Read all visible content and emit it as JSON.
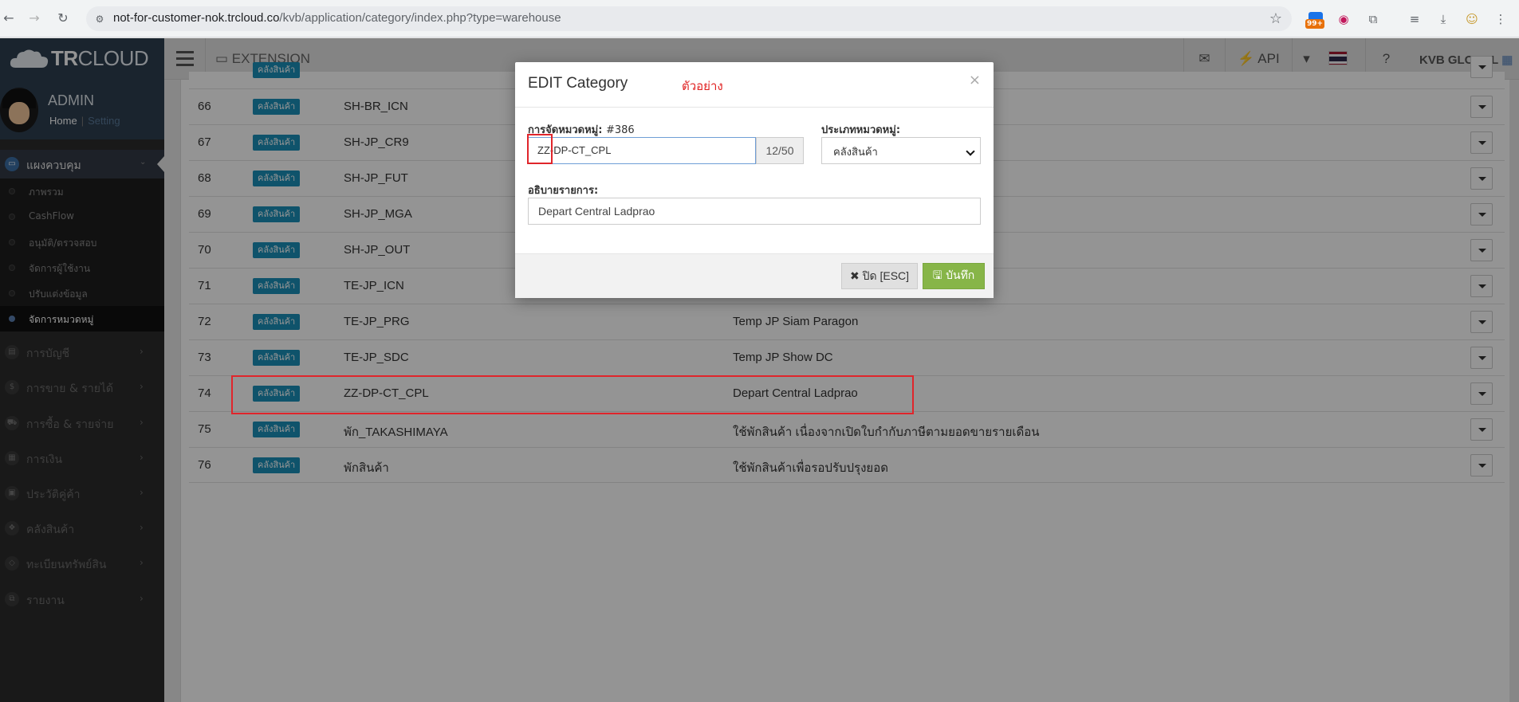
{
  "browser": {
    "url_host": "not-for-customer-nok.trcloud.co",
    "url_path": "/kvb/application/category/index.php?type=warehouse",
    "notif_count": "99+"
  },
  "header": {
    "brand_bold": "TR",
    "brand_light": "CLOUD",
    "extension_label": "EXTENSION",
    "api_label": "API",
    "company": "KVB GLOBAL"
  },
  "sidebar": {
    "user_name": "ADMIN",
    "home_link": "Home",
    "setting_link": "Setting",
    "main_menu": "แผงควบคุม",
    "sub_items": [
      {
        "label": "ภาพรวม"
      },
      {
        "label": "CashFlow"
      },
      {
        "label": "อนุมัติ/ตรวจสอบ"
      },
      {
        "label": "จัดการผู้ใช้งาน"
      },
      {
        "label": "ปรับแต่งข้อมูล"
      },
      {
        "label": "จัดการหมวดหมู่"
      }
    ],
    "categories": [
      {
        "label": "การบัญชี",
        "icon": "book-icon"
      },
      {
        "label": "การขาย & รายได้",
        "icon": "dollar-icon"
      },
      {
        "label": "การซื้อ & รายจ่าย",
        "icon": "cart-icon"
      },
      {
        "label": "การเงิน",
        "icon": "calendar-icon"
      },
      {
        "label": "ประวัติคู่ค้า",
        "icon": "contact-icon"
      },
      {
        "label": "คลังสินค้า",
        "icon": "cubes-icon"
      },
      {
        "label": "ทะเบียนทรัพย์สิน",
        "icon": "diamond-icon"
      },
      {
        "label": "รายงาน",
        "icon": "copy-icon"
      }
    ]
  },
  "table": {
    "badge_label": "คลังสินค้า",
    "rows": [
      {
        "num": "66",
        "code": "SH-BR_ICN",
        "desc": ""
      },
      {
        "num": "67",
        "code": "SH-JP_CR9",
        "desc": ""
      },
      {
        "num": "68",
        "code": "SH-JP_FUT",
        "desc": ""
      },
      {
        "num": "69",
        "code": "SH-JP_MGA",
        "desc": ""
      },
      {
        "num": "70",
        "code": "SH-JP_OUT",
        "desc": ""
      },
      {
        "num": "71",
        "code": "TE-JP_ICN",
        "desc": ""
      },
      {
        "num": "72",
        "code": "TE-JP_PRG",
        "desc": "Temp JP Siam Paragon"
      },
      {
        "num": "73",
        "code": "TE-JP_SDC",
        "desc": "Temp JP Show DC"
      },
      {
        "num": "74",
        "code": "ZZ-DP-CT_CPL",
        "desc": "Depart Central Ladprao"
      },
      {
        "num": "75",
        "code": "พัก_TAKASHIMAYA",
        "desc": "ใช้พักสินค้า เนื่องจากเปิดใบกำกับภาษีตามยอดขายรายเดือน"
      },
      {
        "num": "76",
        "code": "พักสินค้า",
        "desc": "ใช้พักสินค้าเพื่อรอปรับปรุงยอด"
      }
    ]
  },
  "modal": {
    "title": "EDIT Category",
    "example_label": "ตัวอย่าง",
    "close_symbol": "×",
    "category_label": "การจัดหมวดหมู่:",
    "category_id": "#386",
    "category_value": "ZZ-DP-CT_CPL",
    "char_counter": "12/50",
    "type_label": "ประเภทหมวดหมู่:",
    "type_value": "คลังสินค้า",
    "desc_label": "อธิบายรายการ:",
    "desc_value": "Depart Central Ladprao",
    "btn_close": "ปิด [ESC]",
    "btn_save": "บันทึก"
  },
  "colors": {
    "badge": "#1a8fb8",
    "save_button": "#87b548",
    "annotation_red": "#e0252b"
  }
}
